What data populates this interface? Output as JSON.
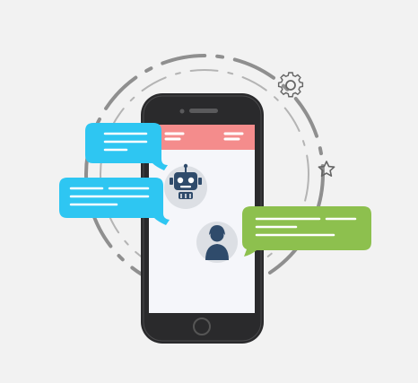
{
  "illustration": {
    "subject": "mobile-chatbot-conversation",
    "icons": [
      "robot-icon",
      "user-icon",
      "gear-icon",
      "star-icon"
    ],
    "colors": {
      "background": "#f2f2f2",
      "ring": "#8f8f8f",
      "phone_body": "#2a2a2c",
      "phone_screen": "#f5f6fa",
      "app_header": "#f48c8c",
      "bubble_blue": "#2ec6f2",
      "bubble_green": "#8dc04e",
      "avatar_bg": "#dcdfe4",
      "avatar_fg": "#2f4b6b"
    }
  }
}
